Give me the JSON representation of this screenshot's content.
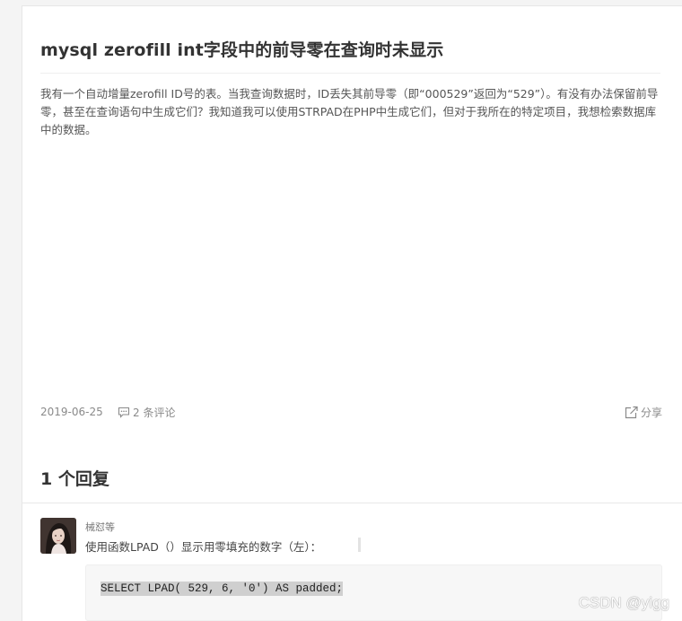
{
  "question": {
    "title": "mysql zerofill int字段中的前导零在查询时未显示",
    "body": "我有一个自动增量zerofill ID号的表。当我查询数据时，ID丢失其前导零（即“000529”返回为“529”）。有没有办法保留前导零，甚至在查询语句中生成它们？我知道我可以使用STRPAD在PHP中生成它们，但对于我所在的特定项目，我想检索数据库中的数据。",
    "date": "2019-06-25",
    "comments_label": "2 条评论",
    "share_label": "分享",
    "icons": {
      "comments": "comment-icon",
      "share": "share-icon"
    }
  },
  "replies": {
    "title": "1 个回复",
    "items": [
      {
        "author": "械怼等",
        "text": "使用函数LPAD（）显示用零填充的数字（左）：",
        "code": "SELECT LPAD( 529, 6, '0') AS padded;"
      }
    ]
  },
  "watermark": "CSDN @yigg",
  "colors": {
    "background": "#f4f4f4",
    "card": "#ffffff",
    "title": "#333333",
    "muted": "#8a8a8a",
    "code_highlight": "#cfcfcf"
  }
}
